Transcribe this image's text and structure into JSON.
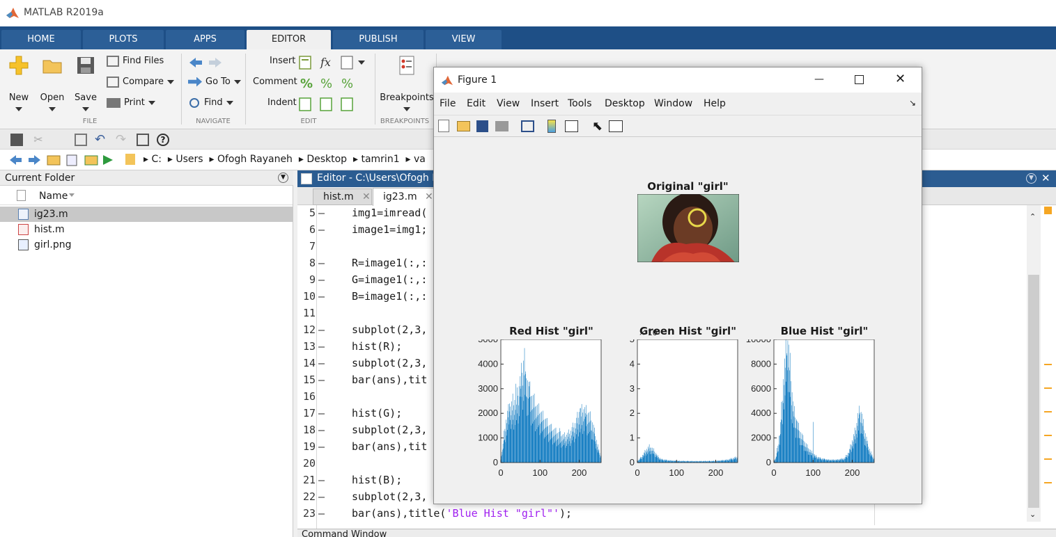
{
  "app": {
    "title": "MATLAB R2019a"
  },
  "tabs": [
    "HOME",
    "PLOTS",
    "APPS",
    "EDITOR",
    "PUBLISH",
    "VIEW"
  ],
  "active_tab": "EDITOR",
  "ribbon": {
    "file": {
      "label": "FILE",
      "new": "New",
      "open": "Open",
      "save": "Save",
      "find_files": "Find Files",
      "compare": "Compare",
      "print": "Print"
    },
    "navigate": {
      "label": "NAVIGATE",
      "go_to": "Go To",
      "find": "Find"
    },
    "edit": {
      "label": "EDIT",
      "insert": "Insert",
      "comment": "Comment",
      "indent": "Indent"
    },
    "breakpoints": {
      "label": "BREAKPOINTS",
      "breakpoints": "Breakpoints"
    }
  },
  "path": [
    "C:",
    "Users",
    "Ofogh Rayaneh",
    "Desktop",
    "tamrin1",
    "va"
  ],
  "current_folder": {
    "title": "Current Folder",
    "column": "Name",
    "files": [
      {
        "name": "ig23.m",
        "selected": true
      },
      {
        "name": "hist.m",
        "selected": false
      },
      {
        "name": "girl.png",
        "selected": false
      }
    ]
  },
  "editor": {
    "title": "Editor - C:\\Users\\Ofogh R",
    "tabs": [
      "hist.m",
      "ig23.m"
    ],
    "active_tab": "ig23.m",
    "lines": [
      {
        "n": "5",
        "dash": "—",
        "text": "img1=imread("
      },
      {
        "n": "6",
        "dash": "—",
        "text": "image1=img1;"
      },
      {
        "n": "7",
        "dash": "",
        "text": ""
      },
      {
        "n": "8",
        "dash": "—",
        "text": "R=image1(:,:"
      },
      {
        "n": "9",
        "dash": "—",
        "text": "G=image1(:,:"
      },
      {
        "n": "10",
        "dash": "—",
        "text": "B=image1(:,:"
      },
      {
        "n": "11",
        "dash": "",
        "text": ""
      },
      {
        "n": "12",
        "dash": "—",
        "text": "subplot(2,3,"
      },
      {
        "n": "13",
        "dash": "—",
        "text": "hist(R);"
      },
      {
        "n": "14",
        "dash": "—",
        "text": "subplot(2,3,"
      },
      {
        "n": "15",
        "dash": "—",
        "text": "bar(ans),tit"
      },
      {
        "n": "16",
        "dash": "",
        "text": ""
      },
      {
        "n": "17",
        "dash": "—",
        "text": "hist(G);"
      },
      {
        "n": "18",
        "dash": "—",
        "text": "subplot(2,3,"
      },
      {
        "n": "19",
        "dash": "—",
        "text": "bar(ans),tit"
      },
      {
        "n": "20",
        "dash": "",
        "text": ""
      },
      {
        "n": "21",
        "dash": "—",
        "text": "hist(B);"
      },
      {
        "n": "22",
        "dash": "—",
        "text": "subplot(2,3,"
      },
      {
        "n": "23",
        "dash": "—",
        "text": "bar(ans),title("
      }
    ],
    "last_line_string": "'Blue Hist \"girl\"'",
    "last_line_tail": ");"
  },
  "command_window": {
    "title": "Command Window"
  },
  "figure": {
    "title": "Figure 1",
    "menu": [
      "File",
      "Edit",
      "View",
      "Insert",
      "Tools",
      "Desktop",
      "Window",
      "Help"
    ],
    "image_title": "Original \"girl\"",
    "exponent_label": "× 10⁴"
  },
  "chart_data": [
    {
      "type": "bar",
      "title": "Red Hist \"girl\"",
      "xlim": [
        0,
        256
      ],
      "ylim": [
        0,
        5000
      ],
      "xticks": [
        0,
        100,
        200
      ],
      "yticks": [
        0,
        1000,
        2000,
        3000,
        4000,
        5000
      ],
      "color": "#0072bd",
      "profile": [
        [
          0,
          200
        ],
        [
          5,
          600
        ],
        [
          10,
          1200
        ],
        [
          15,
          1600
        ],
        [
          20,
          1800
        ],
        [
          30,
          2000
        ],
        [
          40,
          2200
        ],
        [
          50,
          2800
        ],
        [
          55,
          3300
        ],
        [
          60,
          3600
        ],
        [
          65,
          3000
        ],
        [
          70,
          2600
        ],
        [
          80,
          2200
        ],
        [
          90,
          1900
        ],
        [
          100,
          1700
        ],
        [
          110,
          1500
        ],
        [
          120,
          1300
        ],
        [
          130,
          1150
        ],
        [
          140,
          1050
        ],
        [
          150,
          950
        ],
        [
          160,
          900
        ],
        [
          170,
          950
        ],
        [
          180,
          1100
        ],
        [
          190,
          1350
        ],
        [
          200,
          1700
        ],
        [
          210,
          1800
        ],
        [
          220,
          1700
        ],
        [
          230,
          1500
        ],
        [
          240,
          1000
        ],
        [
          250,
          400
        ],
        [
          255,
          250
        ]
      ],
      "spikes": [
        [
          22,
          2400
        ],
        [
          30,
          2800
        ],
        [
          38,
          3200
        ],
        [
          50,
          3000
        ],
        [
          60,
          4650
        ],
        [
          63,
          3700
        ],
        [
          72,
          3100
        ],
        [
          85,
          2800
        ],
        [
          150,
          1400
        ],
        [
          202,
          2200
        ],
        [
          215,
          2000
        ]
      ]
    },
    {
      "type": "bar",
      "title": "Green Hist \"girl\"",
      "xlim": [
        0,
        256
      ],
      "ylim": [
        0,
        5
      ],
      "xticks": [
        0,
        100,
        200
      ],
      "yticks": [
        0,
        1,
        2,
        3,
        4,
        5
      ],
      "color": "#0072bd",
      "profile": [
        [
          0,
          0.05
        ],
        [
          10,
          0.2
        ],
        [
          20,
          0.4
        ],
        [
          30,
          0.55
        ],
        [
          40,
          0.45
        ],
        [
          50,
          0.25
        ],
        [
          60,
          0.12
        ],
        [
          80,
          0.08
        ],
        [
          100,
          0.06
        ],
        [
          150,
          0.05
        ],
        [
          200,
          0.06
        ],
        [
          230,
          0.1
        ],
        [
          250,
          0.18
        ],
        [
          255,
          0.2
        ]
      ],
      "spikes": []
    },
    {
      "type": "bar",
      "title": "Blue Hist \"girl\"",
      "xlim": [
        0,
        256
      ],
      "ylim": [
        0,
        10000
      ],
      "xticks": [
        0,
        100,
        200
      ],
      "yticks": [
        0,
        2000,
        4000,
        6000,
        8000,
        10000
      ],
      "color": "#0072bd",
      "profile": [
        [
          0,
          100
        ],
        [
          5,
          400
        ],
        [
          10,
          1200
        ],
        [
          15,
          2200
        ],
        [
          20,
          4000
        ],
        [
          25,
          6000
        ],
        [
          30,
          7500
        ],
        [
          35,
          8200
        ],
        [
          40,
          7000
        ],
        [
          45,
          5000
        ],
        [
          50,
          3600
        ],
        [
          60,
          2600
        ],
        [
          70,
          1900
        ],
        [
          80,
          1300
        ],
        [
          90,
          900
        ],
        [
          100,
          600
        ],
        [
          110,
          400
        ],
        [
          120,
          300
        ],
        [
          140,
          200
        ],
        [
          160,
          200
        ],
        [
          180,
          300
        ],
        [
          190,
          700
        ],
        [
          200,
          1500
        ],
        [
          210,
          2500
        ],
        [
          215,
          3300
        ],
        [
          220,
          3600
        ],
        [
          225,
          3100
        ],
        [
          230,
          2300
        ],
        [
          240,
          1200
        ],
        [
          250,
          500
        ],
        [
          255,
          300
        ]
      ],
      "spikes": [
        [
          33,
          8700
        ],
        [
          58,
          3400
        ],
        [
          100,
          3300
        ],
        [
          218,
          3900
        ]
      ]
    }
  ]
}
